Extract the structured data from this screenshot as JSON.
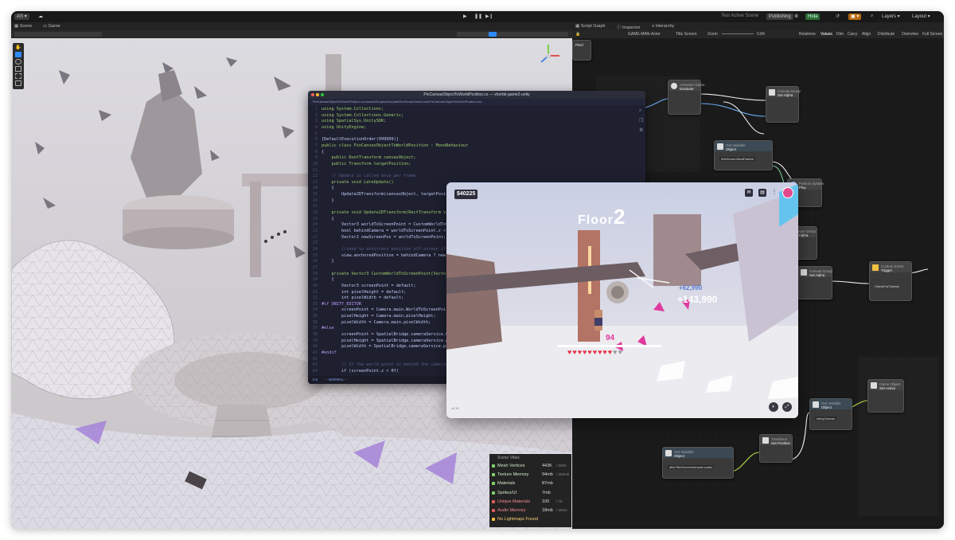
{
  "topbar": {
    "account": "AS",
    "test_active_scene": "Test Active Scene",
    "publishing": "Publishing",
    "hola": "Hola",
    "layers": "Layers",
    "layout": "Layout"
  },
  "tabs": {
    "scene": "Scene",
    "game": "Game",
    "script_graph": "Script Graph",
    "inspector": "Inspector",
    "hierarchy": "Hierarchy"
  },
  "graph_toolbar": {
    "game_object": "GAME-MAN-Actor",
    "title_screen": "Title Screen",
    "zoom_label": "Zoom",
    "zoom_value": "0.84",
    "relations": "Relations",
    "values": "Values",
    "dim": "Dim",
    "carry": "Carry",
    "align": "Align",
    "distribute": "Distribute",
    "overview": "Overview",
    "full_screen": "Full Screen"
  },
  "editor": {
    "title": "PinCanvasObjectToWorldPosition.cs — sherbb-game2-unity",
    "breadcrumb": "PinCanvasObjectToWorldPosition.cs  Assets/Scripts/DeepwikiSrc/Deals/ViewCode/PinCanvasObjectToWorldPosition.cs/...",
    "status_mode": "-- NORMAL --",
    "status_pos": "0,0",
    "lines": [
      {
        "n": "1",
        "t": "using System.Collections;"
      },
      {
        "n": "2",
        "t": "using System.Collections.Generic;"
      },
      {
        "n": "3",
        "t": "using SpatialSys.UnitySDK;"
      },
      {
        "n": "4",
        "t": "using UnityEngine;"
      },
      {
        "n": "5",
        "t": ""
      },
      {
        "n": "6",
        "t": "[DefaultExecutionOrder(999999)]"
      },
      {
        "n": "7",
        "t": "public class PinCanvasObjectToWorldPosition : MonoBehaviour"
      },
      {
        "n": "8",
        "t": "{"
      },
      {
        "n": "9",
        "t": "    public RootTransform canvasObject;"
      },
      {
        "n": "10",
        "t": "    public Transform targetPosition;"
      },
      {
        "n": "11",
        "t": ""
      },
      {
        "n": "12",
        "t": "    // Update is called once per frame"
      },
      {
        "n": "13",
        "t": "    private void LateUpdate()"
      },
      {
        "n": "14",
        "t": "    {"
      },
      {
        "n": "15",
        "t": "        Update2DTransform(canvasObject, targetPosit"
      },
      {
        "n": "16",
        "t": "    }"
      },
      {
        "n": "17",
        "t": ""
      },
      {
        "n": "18",
        "t": "    private void Update2DTransform(RectTransform vie"
      },
      {
        "n": "19",
        "t": "    {"
      },
      {
        "n": "20",
        "t": "        Vector3 worldToScreenPoint = CustomWorldToS"
      },
      {
        "n": "21",
        "t": "        bool behindCamera = worldToScreenPoint.z <"
      },
      {
        "n": "22",
        "t": "        Vector2 newScreenPos = worldToScreenPoint;"
      },
      {
        "n": "23",
        "t": ""
      },
      {
        "n": "24",
        "t": "        //send to arbitrary position off-screen if"
      },
      {
        "n": "25",
        "t": "        view.anchoredPosition = behindCamera ? new"
      },
      {
        "n": "26",
        "t": "    }"
      },
      {
        "n": "27",
        "t": ""
      },
      {
        "n": "28",
        "t": "    private Vector3 CustomWorldToScreenPoint(Vector"
      },
      {
        "n": "29",
        "t": "    {"
      },
      {
        "n": "30",
        "t": "        Vector3 screenPoint = default;"
      },
      {
        "n": "31",
        "t": "        int pixelHeight = default;"
      },
      {
        "n": "32",
        "t": "        int pixelWidth = default;"
      },
      {
        "n": "33",
        "t": "#if UNITY_EDITOR"
      },
      {
        "n": "34",
        "t": "        screenPoint = Camera.main.WorldToScreenPoi"
      },
      {
        "n": "35",
        "t": "        pixelHeight = Camera.main.pixelHeight;"
      },
      {
        "n": "36",
        "t": "        pixelWidth = Camera.main.pixelWidth;"
      },
      {
        "n": "37",
        "t": "#else"
      },
      {
        "n": "38",
        "t": "        screenPoint = SpatialBridge.cameraService.Wo"
      },
      {
        "n": "39",
        "t": "        pixelHeight = SpatialBridge.cameraService.pi"
      },
      {
        "n": "40",
        "t": "        pixelWidth = SpatialBridge.cameraService.pi"
      },
      {
        "n": "41",
        "t": "#endif"
      },
      {
        "n": "42",
        "t": ""
      },
      {
        "n": "43",
        "t": "        // If the world point is behind the camera,"
      },
      {
        "n": "44",
        "t": "        if (screenPoint.z < 0f)"
      }
    ]
  },
  "game": {
    "currency": "$40225",
    "floor": "Floor",
    "floor_num": "2",
    "score_popup": "+143,990",
    "score_small": "+62,990",
    "hp_value": "94",
    "hearts_full": 9,
    "hearts_total": 11,
    "version": "v0.10"
  },
  "nodes": [
    {
      "title": "Pixel",
      "sub": "",
      "id": "pixel"
    },
    {
      "title": "Animator Game",
      "sub": "Evaluate",
      "id": "animator-game"
    },
    {
      "title": "Canvas Group",
      "sub": "Set Alpha",
      "id": "canvas-group-1"
    },
    {
      "title": "Get Variable",
      "sub": "Object",
      "field": "WinScreenStartParticle",
      "id": "get-variable-1"
    },
    {
      "title": "Particle System",
      "sub": "Play",
      "id": "particle-system"
    },
    {
      "title": "Scene Variable",
      "sub": "",
      "id": "scene-variable"
    },
    {
      "title": "Canvas Group",
      "sub": "Set Alpha",
      "id": "canvas-group-2"
    },
    {
      "title": "Canvas Group",
      "sub": "Set Alpha",
      "id": "canvas-group-3"
    },
    {
      "title": "Custom Event",
      "sub": "Trigger",
      "extra": "CheckForTutorial",
      "id": "custom-event"
    },
    {
      "title": "Game Object",
      "sub": "Set Active",
      "id": "game-object"
    },
    {
      "title": "Get Variable",
      "sub": "Object",
      "field": "lobbyCanvas",
      "id": "get-variable-2"
    },
    {
      "title": "Transform",
      "sub": "Set Position",
      "id": "transform"
    },
    {
      "title": "Get Variable",
      "sub": "Object",
      "field": "afterTitleScreenInteractLocatio",
      "id": "get-variable-3"
    }
  ],
  "stats": {
    "title": "Scene Vitals",
    "rows": [
      {
        "label": "Mesh Vertices",
        "value": "443K",
        "limit": "/ 500K",
        "color": "#7fd36a"
      },
      {
        "label": "Texture Memory",
        "value": "94mb",
        "limit": "/ 256mb",
        "color": "#7fd36a"
      },
      {
        "label": "Materials",
        "value": "87mb",
        "limit": "",
        "color": "#7fd36a"
      },
      {
        "label": "Sprites/UI",
        "value": "7mb",
        "limit": "",
        "color": "#7fd36a"
      },
      {
        "label": "Unique Materials",
        "value": "100",
        "limit": "/ 75",
        "color": "#e25a5a"
      },
      {
        "label": "Audio Memory",
        "value": "18mb",
        "limit": "/ 30mb",
        "color": "#e25a5a"
      },
      {
        "label": "No Lightmaps Found",
        "value": "",
        "limit": "",
        "color": "#f0c040"
      }
    ]
  },
  "colors": {
    "accent": "#2e8bff",
    "editor_bg": "#1e2030",
    "green": "#58b55a"
  }
}
